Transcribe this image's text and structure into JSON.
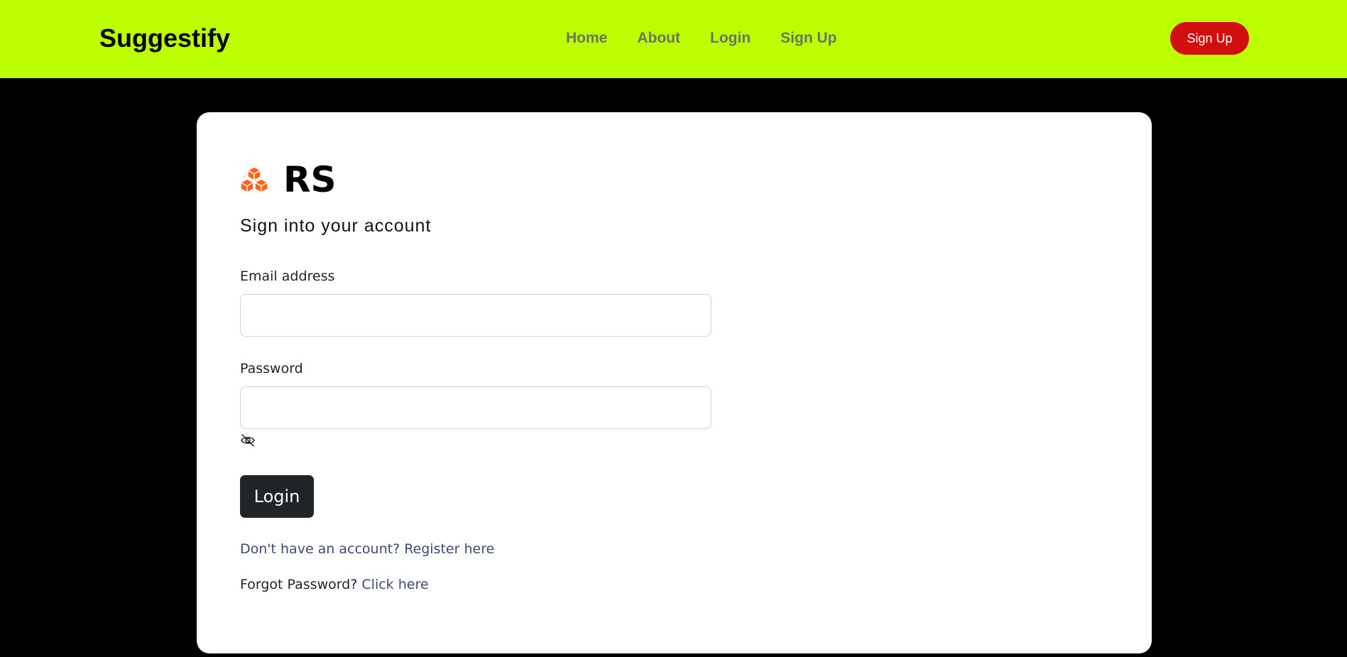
{
  "navbar": {
    "brand": "Suggestify",
    "links": [
      "Home",
      "About",
      "Login",
      "Sign Up"
    ],
    "cta_label": "Sign Up",
    "bg_color": "#bbff00",
    "cta_color": "#d10f0f"
  },
  "card": {
    "logo_icon": "cubes-icon",
    "logo_text": "RS",
    "subtitle": "Sign into your account",
    "email": {
      "label": "Email address",
      "value": "",
      "placeholder": ""
    },
    "password": {
      "label": "Password",
      "value": "",
      "placeholder": ""
    },
    "toggle_icon": "eye-slash-icon",
    "login_label": "Login",
    "register": {
      "text": "Don't have an account? Register here"
    },
    "forgot": {
      "prefix": "Forgot Password?",
      "link": "Click here"
    }
  }
}
